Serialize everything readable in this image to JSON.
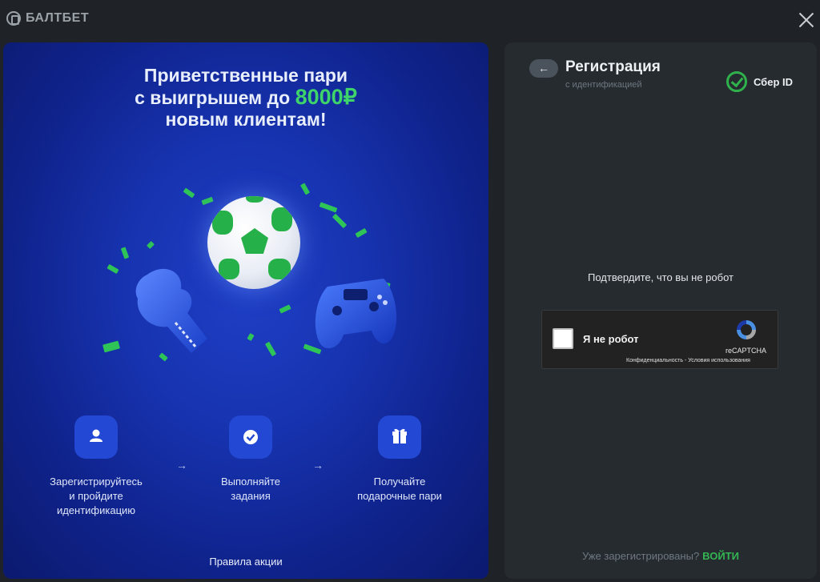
{
  "header": {
    "logo_text": "БАЛТБЕТ",
    "close_icon": "close-icon"
  },
  "promo": {
    "title_line1": "Приветственные пари",
    "title_line2_prefix": "с выигрышем до ",
    "title_amount": "8000₽",
    "title_line3": "новым клиентам!",
    "steps": [
      {
        "icon": "user-icon",
        "label_line1": "Зарегистрируйтесь",
        "label_line2": "и пройдите",
        "label_line3": "идентификацию"
      },
      {
        "icon": "check-icon",
        "label_line1": "Выполняйте",
        "label_line2": "задания"
      },
      {
        "icon": "gift-icon",
        "label_line1": "Получайте",
        "label_line2": "подарочные пари"
      }
    ],
    "arrow": "→",
    "rules_link": "Правила акции",
    "colors": {
      "accent_green": "#3fd46a",
      "panel_blue": "#1733b0"
    }
  },
  "registration": {
    "back_label": "←",
    "title": "Регистрация",
    "subtitle": "с идентификацией",
    "sber_label": "Сбер ID",
    "robot_prompt": "Подтвердите, что вы не робот",
    "captcha": {
      "label": "Я не робот",
      "brand": "reCAPTCHA",
      "privacy": "Конфиденциальность",
      "separator": " - ",
      "terms": "Условия использования"
    },
    "already_registered": "Уже зарегистрированы?",
    "login_link": "ВОЙТИ",
    "colors": {
      "sber_green": "#2fb24c",
      "panel_bg": "#262b30"
    }
  }
}
